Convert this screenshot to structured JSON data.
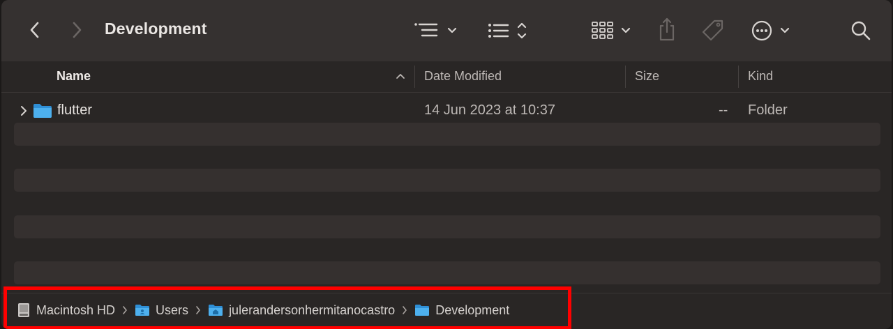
{
  "window": {
    "title": "Development"
  },
  "toolbar": {
    "back_icon": "chevron-left-icon",
    "forward_icon": "chevron-right-icon",
    "view_options_icon": "list-view-icon",
    "group_icon": "list-group-icon",
    "icon_view_icon": "grid-icon",
    "share_icon": "share-icon",
    "tag_icon": "tag-icon",
    "more_icon": "ellipsis-circle-icon",
    "search_icon": "search-icon"
  },
  "columns": {
    "name": "Name",
    "date_modified": "Date Modified",
    "size": "Size",
    "kind": "Kind"
  },
  "files": [
    {
      "name": "flutter",
      "date_modified": "14 Jun 2023 at 10:37",
      "size": "--",
      "kind": "Folder"
    }
  ],
  "path_bar": {
    "items": [
      {
        "label": "Macintosh HD",
        "icon": "hard-drive-icon"
      },
      {
        "label": "Users",
        "icon": "users-folder-icon"
      },
      {
        "label": "julerandersonhermitanocastro",
        "icon": "home-folder-icon"
      },
      {
        "label": "Development",
        "icon": "folder-icon"
      }
    ]
  },
  "colors": {
    "highlight": "#ff0000",
    "folder": "#3ea3e6",
    "background": "#292625"
  }
}
